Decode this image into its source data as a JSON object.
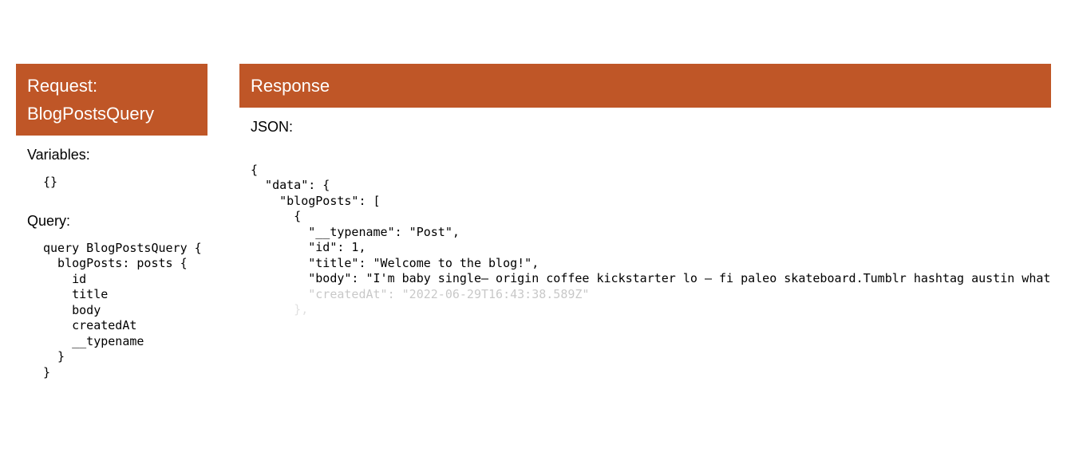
{
  "request": {
    "header": "Request: BlogPostsQuery",
    "variablesLabel": "Variables:",
    "variablesBody": "{}",
    "queryLabel": "Query:",
    "queryBody": "query BlogPostsQuery {\n  blogPosts: posts {\n    id\n    title\n    body\n    createdAt\n    __typename\n  }\n}"
  },
  "response": {
    "header": "Response",
    "jsonLabel": "JSON:",
    "lines": {
      "l1": "{",
      "l2": "  \"data\": {",
      "l3": "    \"blogPosts\": [",
      "l4": "      {",
      "l5": "        \"__typename\": \"Post\",",
      "l6": "        \"id\": 1,",
      "l7": "        \"title\": \"Welcome to the blog!\",",
      "l8": "        \"body\": \"I'm baby single– origin coffee kickstarter lo – fi paleo skateboard.Tumblr hashtag austin whatever DIY pl",
      "l9": "        \"createdAt\": \"2022-06-29T16:43:38.589Z\"",
      "l10": "      },"
    }
  }
}
